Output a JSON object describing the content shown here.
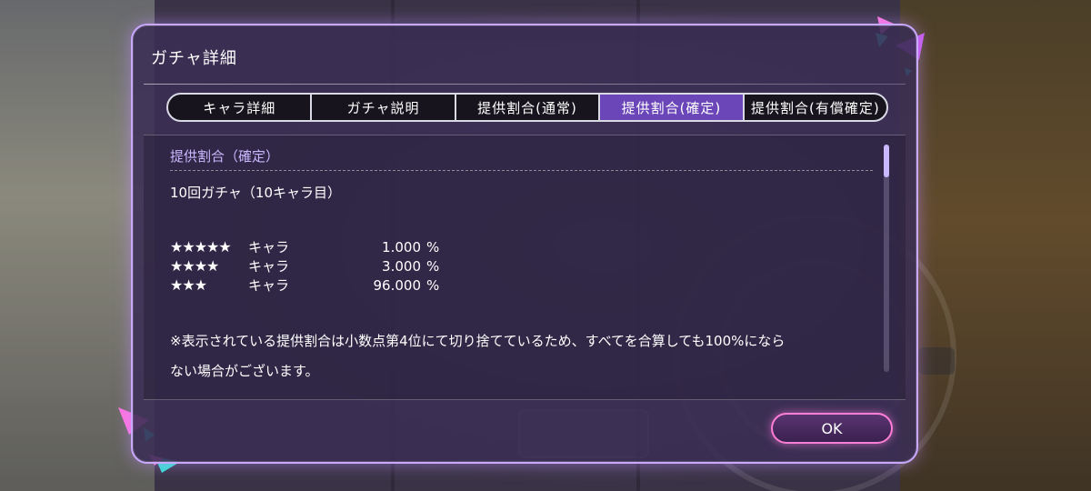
{
  "dialog": {
    "title": "ガチャ詳細",
    "tabs": [
      {
        "label": "キャラ詳細",
        "active": false
      },
      {
        "label": "ガチャ説明",
        "active": false
      },
      {
        "label": "提供割合(通常)",
        "active": false
      },
      {
        "label": "提供割合(確定)",
        "active": true
      },
      {
        "label": "提供割合(有償確定)",
        "active": false
      }
    ],
    "section_heading": "提供割合（確定）",
    "sub_heading": "10回ガチャ（10キャラ目）",
    "rates": [
      {
        "stars": "★★★★★",
        "label": "キャラ",
        "value": "1.000",
        "unit": "%"
      },
      {
        "stars": "★★★★",
        "label": "キャラ",
        "value": "3.000",
        "unit": "%"
      },
      {
        "stars": "★★★",
        "label": "キャラ",
        "value": "96.000",
        "unit": "%"
      }
    ],
    "note_line1": "※表示されている提供割合は小数点第4位にて切り捨てているため、すべてを合算しても100%になら",
    "note_line2": "ない場合がございます。",
    "ok_label": "OK"
  },
  "colors": {
    "accent": "#6b46b8",
    "dialog_border": "#c9a8ff",
    "ok_border": "#ff7fd6",
    "heading": "#c9b8ff"
  }
}
